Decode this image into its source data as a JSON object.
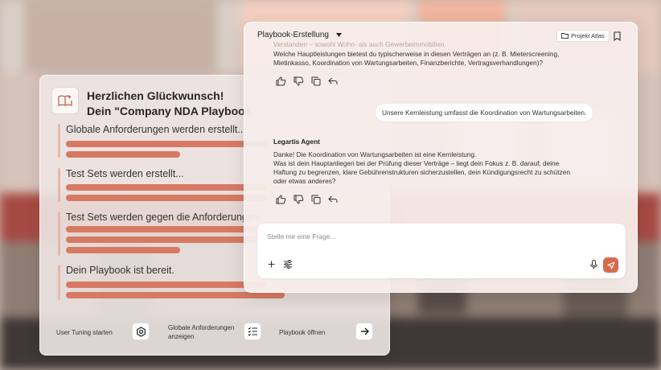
{
  "onboarding": {
    "title": "Herzlichen Glückwunsch!",
    "subtitle": "Dein \"Company NDA Playbook",
    "steps": [
      {
        "label": "Globale Anforderungen werden erstellt..."
      },
      {
        "label": "Test Sets werden erstellt..."
      },
      {
        "label": "Test Sets werden gegen die Anforderungen"
      },
      {
        "label": "Dein Playbook ist bereit."
      }
    ],
    "footer": {
      "tuning_label": "User Tuning starten",
      "requirements_label_1": "Globale Anforderungen",
      "requirements_label_2": "anzeigen",
      "open_label": "Playbook öffnen"
    }
  },
  "chat": {
    "title": "Playbook-Erstellung",
    "project_label": "Projekt Atlas",
    "faded_line": "Verstanden – sowohl Wohn- als auch Gewerbeimmobilien.",
    "agent_message_1": [
      "Welche Hauptleistungen bietest du typischerweise in diesen Verträgen an (z. B. Mieterscreening,",
      "Mietinkasso, Koordination von Wartungsarbeiten, Finanzberichte, Vertragsverhandlungen)?"
    ],
    "user_message": "Unsere Kernleistung umfasst die Koordination von Wartungsarbeiten.",
    "agent_name": "Legartis Agent",
    "agent_message_2": [
      "Danke! Die Koordination von Wartungsarbeiten ist eine Kernleistung.",
      "Was ist dein Hauptanliegen bei der Prüfung dieser Verträge – liegt dein Fokus z. B. darauf, deine",
      "Haftung zu begrenzen, klare Gebührenstrukturen sicherzustellen, dein Kündigungsrecht zu schützen",
      "oder etwas anderes?"
    ],
    "composer_placeholder": "Stelle mir eine Frage..."
  },
  "colors": {
    "accent": "#d76a4f",
    "progress_line": "#d77a63"
  }
}
